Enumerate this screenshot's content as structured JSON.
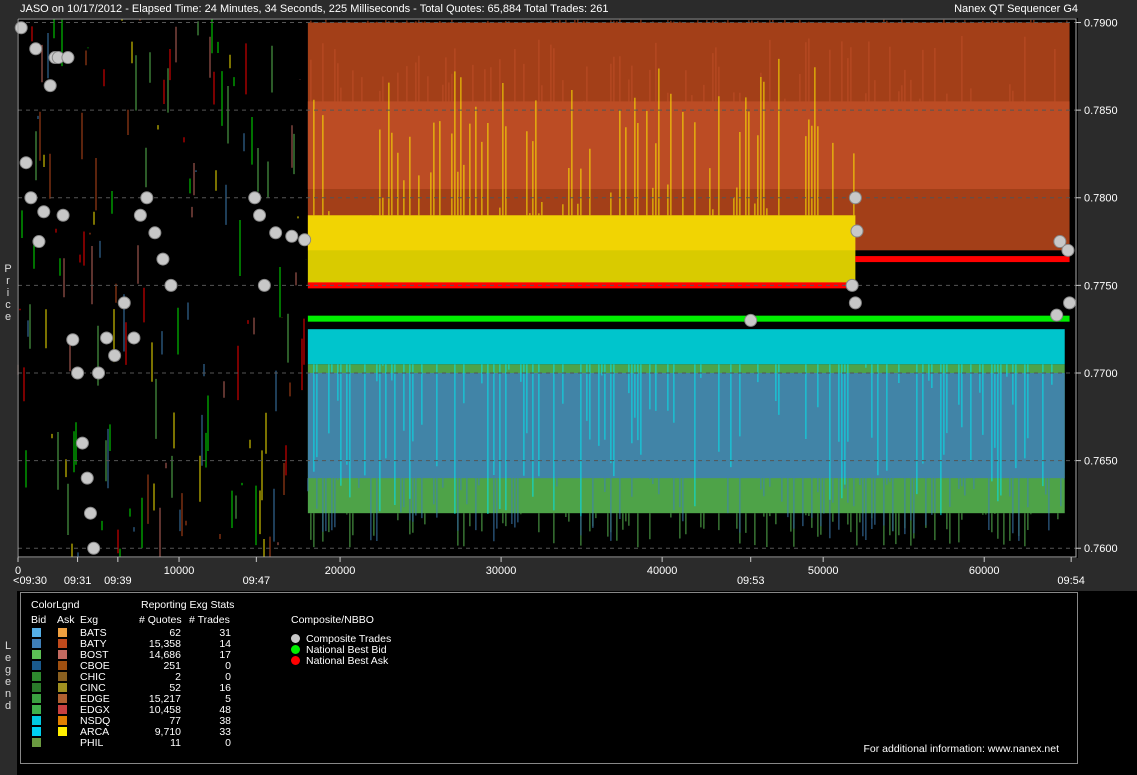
{
  "header": {
    "title": "JASO on 10/17/2012  -  Elapsed Time: 24 Minutes, 34 Seconds, 225 Milliseconds  -  Total Quotes: 65,884  Total Trades: 261",
    "app": "Nanex QT Sequencer G4"
  },
  "y_axis_label": "Price",
  "legend_side_label": "Legend",
  "chart_data": {
    "type": "scatter",
    "title": "",
    "xlabel": "",
    "ylabel": "Price",
    "xlim": [
      0,
      65700
    ],
    "ylim": [
      0.7595,
      0.7902
    ],
    "y_ticks": [
      {
        "value": 0.79,
        "label": "0.7900"
      },
      {
        "value": 0.785,
        "label": "0.7850"
      },
      {
        "value": 0.78,
        "label": "0.7800"
      },
      {
        "value": 0.775,
        "label": "0.7750"
      },
      {
        "value": 0.77,
        "label": "0.7700"
      },
      {
        "value": 0.765,
        "label": "0.7650"
      },
      {
        "value": 0.76,
        "label": "0.7600"
      }
    ],
    "x_ticks": [
      {
        "value": 0,
        "label": "0",
        "time": "<09:30"
      },
      {
        "value": 3700,
        "label": "",
        "time": "09:31"
      },
      {
        "value": 6200,
        "label": "",
        "time": "09:39"
      },
      {
        "value": 10000,
        "label": "10000",
        "time": ""
      },
      {
        "value": 14800,
        "label": "",
        "time": "09:47"
      },
      {
        "value": 20000,
        "label": "20000",
        "time": ""
      },
      {
        "value": 30000,
        "label": "30000",
        "time": ""
      },
      {
        "value": 40000,
        "label": "40000",
        "time": ""
      },
      {
        "value": 45500,
        "label": "",
        "time": "09:53"
      },
      {
        "value": 50000,
        "label": "50000",
        "time": ""
      },
      {
        "value": 60000,
        "label": "60000",
        "time": ""
      },
      {
        "value": 65400,
        "label": "",
        "time": "09:54"
      }
    ],
    "grid": true,
    "bands": [
      {
        "exchange": "BOST",
        "side": "ask",
        "color": "#c46a60",
        "x": [
          18000,
          65300
        ],
        "low": 0.7805,
        "high": 0.7855
      },
      {
        "exchange": "BATY",
        "side": "ask",
        "color": "#c04a1c",
        "x": [
          18000,
          65300
        ],
        "low": 0.777,
        "high": 0.79
      },
      {
        "exchange": "ARCA",
        "side": "ask",
        "color": "#ffee00",
        "x": [
          18000,
          52000
        ],
        "low": 0.775,
        "high": 0.779
      },
      {
        "exchange": "EDGX",
        "side": "bid",
        "color": "#5cc055",
        "x": [
          18000,
          65000
        ],
        "low": 0.762,
        "high": 0.7705
      },
      {
        "exchange": "BATY",
        "side": "bid",
        "color": "#3f7fb8",
        "x": [
          18000,
          65000
        ],
        "low": 0.764,
        "high": 0.77
      },
      {
        "exchange": "NSDQ",
        "side": "bid",
        "color": "#00e8f0",
        "x": [
          18000,
          65000
        ],
        "low": 0.7705,
        "high": 0.7725
      }
    ],
    "nbbo": [
      {
        "series": "National Best Ask",
        "color": "#ff0000",
        "x": [
          18000,
          52000
        ],
        "value": 0.775
      },
      {
        "series": "National Best Ask",
        "color": "#ff0000",
        "x": [
          52000,
          65300
        ],
        "value": 0.7765
      },
      {
        "series": "National Best Bid",
        "color": "#00ee00",
        "x": [
          18000,
          65300
        ],
        "value": 0.7731
      }
    ],
    "trades_sample": [
      {
        "x": 200,
        "y": 0.7897
      },
      {
        "x": 500,
        "y": 0.782
      },
      {
        "x": 800,
        "y": 0.78
      },
      {
        "x": 1100,
        "y": 0.7885
      },
      {
        "x": 1300,
        "y": 0.7775
      },
      {
        "x": 1600,
        "y": 0.7792
      },
      {
        "x": 2000,
        "y": 0.7864
      },
      {
        "x": 2300,
        "y": 0.788
      },
      {
        "x": 2500,
        "y": 0.788
      },
      {
        "x": 2800,
        "y": 0.779
      },
      {
        "x": 3100,
        "y": 0.788
      },
      {
        "x": 3400,
        "y": 0.7719
      },
      {
        "x": 3700,
        "y": 0.77
      },
      {
        "x": 4000,
        "y": 0.766
      },
      {
        "x": 4300,
        "y": 0.764
      },
      {
        "x": 4500,
        "y": 0.762
      },
      {
        "x": 4700,
        "y": 0.76
      },
      {
        "x": 5000,
        "y": 0.77
      },
      {
        "x": 5500,
        "y": 0.772
      },
      {
        "x": 6000,
        "y": 0.771
      },
      {
        "x": 6600,
        "y": 0.774
      },
      {
        "x": 7200,
        "y": 0.772
      },
      {
        "x": 7600,
        "y": 0.779
      },
      {
        "x": 8000,
        "y": 0.78
      },
      {
        "x": 8500,
        "y": 0.778
      },
      {
        "x": 9000,
        "y": 0.7765
      },
      {
        "x": 9500,
        "y": 0.775
      },
      {
        "x": 14700,
        "y": 0.78
      },
      {
        "x": 15000,
        "y": 0.779
      },
      {
        "x": 15300,
        "y": 0.775
      },
      {
        "x": 16000,
        "y": 0.778
      },
      {
        "x": 17000,
        "y": 0.7778
      },
      {
        "x": 17800,
        "y": 0.7776
      },
      {
        "x": 45500,
        "y": 0.773
      },
      {
        "x": 52000,
        "y": 0.78
      },
      {
        "x": 52100,
        "y": 0.7781
      },
      {
        "x": 51800,
        "y": 0.775
      },
      {
        "x": 52000,
        "y": 0.774
      },
      {
        "x": 64500,
        "y": 0.7733
      },
      {
        "x": 64700,
        "y": 0.7775
      },
      {
        "x": 65200,
        "y": 0.777
      },
      {
        "x": 65300,
        "y": 0.774
      }
    ]
  },
  "legend": {
    "colorlegend_label": "ColorLgnd",
    "bid_label": "Bid",
    "ask_label": "Ask",
    "exg_label": "Exg",
    "stats_label": "Reporting Exg Stats",
    "quotes_label": "# Quotes",
    "trades_label": "# Trades",
    "composite_label": "Composite/NBBO",
    "rows": [
      {
        "exg": "BATS",
        "quotes": "62",
        "trades": "31",
        "bid_color": "#55b0e8",
        "ask_color": "#f0a040"
      },
      {
        "exg": "BATY",
        "quotes": "15,358",
        "trades": "14",
        "bid_color": "#3f7fb8",
        "ask_color": "#c04a1c"
      },
      {
        "exg": "BOST",
        "quotes": "14,686",
        "trades": "17",
        "bid_color": "#5cc055",
        "ask_color": "#c46a60"
      },
      {
        "exg": "CBOE",
        "quotes": "251",
        "trades": "0",
        "bid_color": "#1a5a8c",
        "ask_color": "#a05010"
      },
      {
        "exg": "CHIC",
        "quotes": "2",
        "trades": "0",
        "bid_color": "#2e8a2e",
        "ask_color": "#8a6020"
      },
      {
        "exg": "CINC",
        "quotes": "52",
        "trades": "16",
        "bid_color": "#2a7a2a",
        "ask_color": "#a09020"
      },
      {
        "exg": "EDGE",
        "quotes": "15,217",
        "trades": "5",
        "bid_color": "#3aa040",
        "ask_color": "#b06030"
      },
      {
        "exg": "EDGX",
        "quotes": "10,458",
        "trades": "48",
        "bid_color": "#3fb04a",
        "ask_color": "#c84040"
      },
      {
        "exg": "NSDQ",
        "quotes": "77",
        "trades": "38",
        "bid_color": "#00c8e0",
        "ask_color": "#e08000"
      },
      {
        "exg": "ARCA",
        "quotes": "9,710",
        "trades": "33",
        "bid_color": "#00d0f0",
        "ask_color": "#ffee00"
      },
      {
        "exg": "PHIL",
        "quotes": "11",
        "trades": "0",
        "bid_color": "#6a9a40",
        "ask_color": ""
      }
    ],
    "composite": [
      {
        "label": "Composite Trades",
        "color": "#c8c8c8"
      },
      {
        "label": "National Best Bid",
        "color": "#00ee00"
      },
      {
        "label": "National Best Ask",
        "color": "#ff0000"
      }
    ],
    "info": "For additional information: www.nanex.net"
  }
}
